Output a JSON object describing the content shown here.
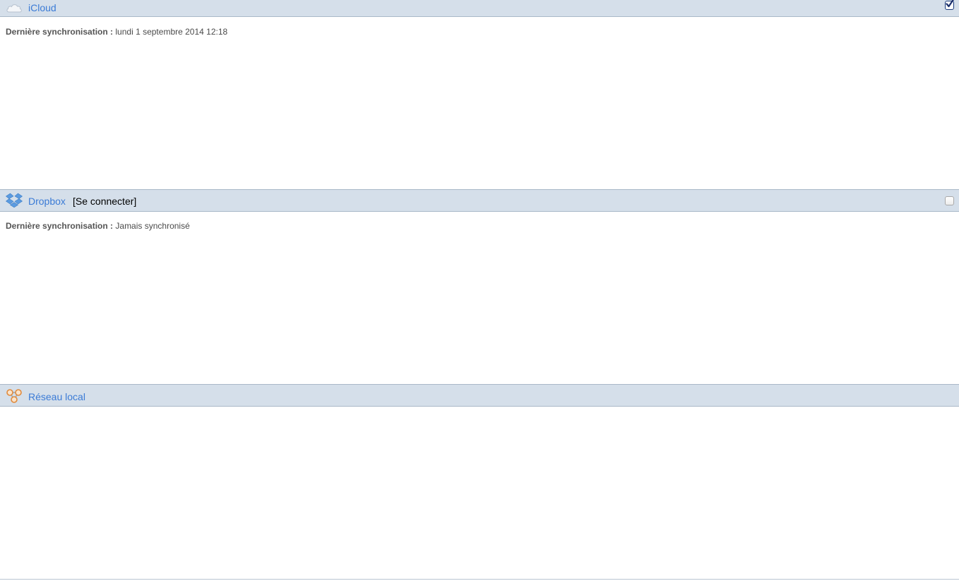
{
  "services": {
    "icloud": {
      "title": "iCloud",
      "icon": "cloud-icon",
      "enabled": true,
      "sync_label": "Dernière synchronisation :",
      "sync_value": "lundi 1 septembre 2014 12:18"
    },
    "dropbox": {
      "title": "Dropbox",
      "icon": "dropbox-icon",
      "connect_label": "[Se connecter]",
      "enabled": false,
      "sync_label": "Dernière synchronisation :",
      "sync_value": "Jamais synchronisé"
    },
    "local": {
      "title": "Réseau local",
      "icon": "local-network-icon"
    }
  },
  "colors": {
    "header_bg": "#d5dfea",
    "link": "#3b7bd6",
    "text": "#4a4a4a"
  }
}
